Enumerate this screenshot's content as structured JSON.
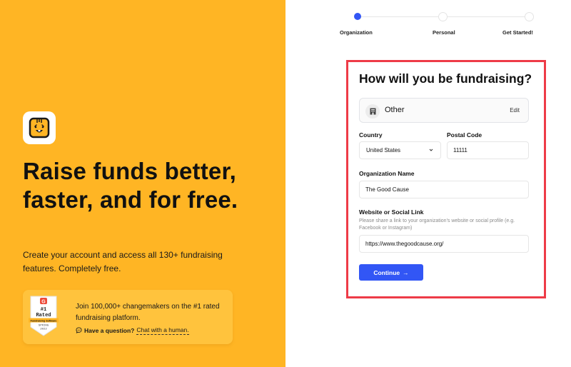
{
  "hero": {
    "logo_icon": "smiley-face-logo",
    "title": "Raise funds better, faster, and for free.",
    "subtitle": "Create your account and access all 130+ fundraising features. Completely free."
  },
  "promo": {
    "badge": {
      "brand": "G",
      "rank": "#1",
      "rated": "Rated",
      "category": "Fundraising Software",
      "season": "SPRING",
      "year": "2022"
    },
    "text": "Join 100,000+ changemakers on the #1 rated fundraising platform.",
    "question_label": "Have a question?",
    "chat_link": "Chat with a human."
  },
  "stepper": {
    "steps": [
      {
        "label": "Organization",
        "active": true
      },
      {
        "label": "Personal",
        "active": false
      },
      {
        "label": "Get Started!",
        "active": false
      }
    ]
  },
  "form": {
    "title": "How will you be fundraising?",
    "fundraising_type": {
      "icon": "building-icon",
      "value": "Other",
      "edit_label": "Edit"
    },
    "country": {
      "label": "Country",
      "value": "United States"
    },
    "postal_code": {
      "label": "Postal Code",
      "value": "11111"
    },
    "organization_name": {
      "label": "Organization Name",
      "value": "The Good Cause"
    },
    "website": {
      "label": "Website or Social Link",
      "help": "Please share a link to your organization's website or social profile (e.g. Facebook or Instagram)",
      "value": "https://www.thegoodcause.org/"
    },
    "continue_label": "Continue",
    "continue_arrow": "→"
  },
  "colors": {
    "left_bg": "#FFB524",
    "promo_bg": "#FFC33D",
    "accent_blue": "#3256F5",
    "highlight_red": "#EE3B47"
  }
}
